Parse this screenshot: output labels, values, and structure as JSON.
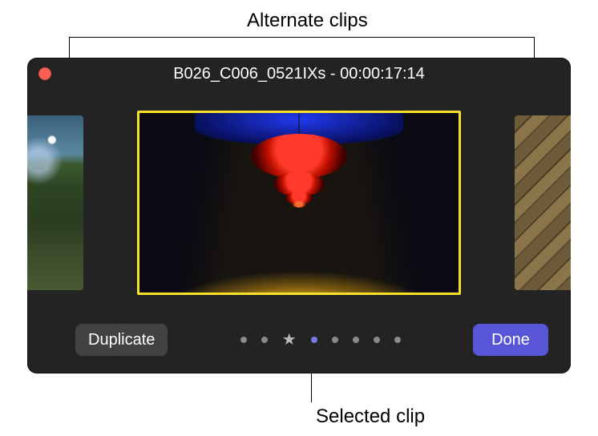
{
  "annotations": {
    "top": "Alternate clips",
    "bottom": "Selected clip"
  },
  "window": {
    "title": "B026_C006_0521IXs - 00:00:17:14"
  },
  "footer": {
    "duplicate_label": "Duplicate",
    "done_label": "Done"
  },
  "pager": {
    "dots": [
      {
        "kind": "dot",
        "active": false
      },
      {
        "kind": "dot",
        "active": false
      },
      {
        "kind": "star",
        "active": false
      },
      {
        "kind": "dot",
        "active": true
      },
      {
        "kind": "dot",
        "active": false
      },
      {
        "kind": "dot",
        "active": false
      },
      {
        "kind": "dot",
        "active": false
      },
      {
        "kind": "dot",
        "active": false
      }
    ]
  },
  "colors": {
    "selection_border": "#f7e02a",
    "done_button": "#5856d6",
    "close_button": "#ff5f57"
  },
  "clips": {
    "alternate_left": {
      "desc": "outdoor forest scene with a bright sky"
    },
    "selected": {
      "desc": "corridor with red pendant lamps, blue ceiling, yellow floor"
    },
    "alternate_right": {
      "desc": "dark geometric textured surface"
    }
  }
}
